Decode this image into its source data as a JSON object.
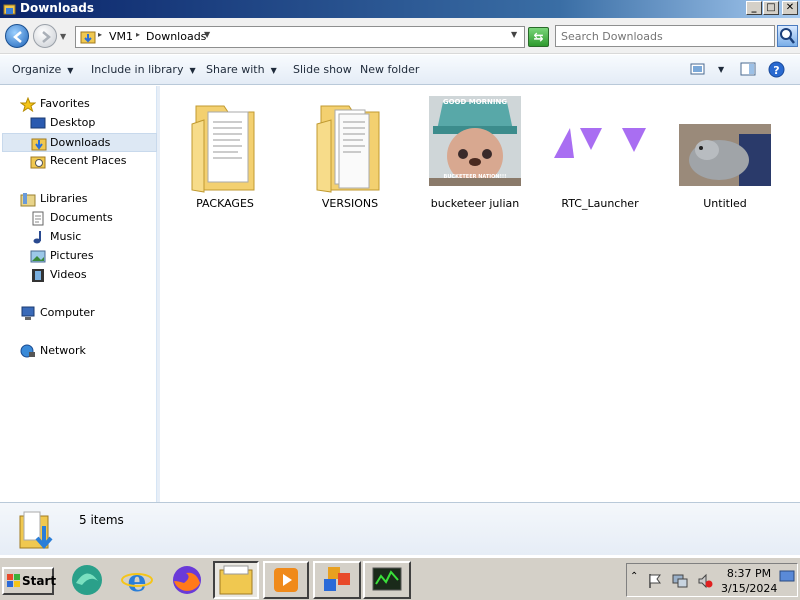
{
  "window": {
    "title": "Downloads"
  },
  "address": {
    "crumbs": [
      "VM1",
      "Downloads"
    ]
  },
  "search": {
    "placeholder": "Search Downloads"
  },
  "commands": {
    "organize": "Organize",
    "include": "Include in library",
    "share": "Share with",
    "slideshow": "Slide show",
    "newfolder": "New folder"
  },
  "nav": {
    "favorites": "Favorites",
    "desktop": "Desktop",
    "downloads": "Downloads",
    "recent": "Recent Places",
    "libraries": "Libraries",
    "documents": "Documents",
    "music": "Music",
    "pictures": "Pictures",
    "videos": "Videos",
    "computer": "Computer",
    "network": "Network"
  },
  "files": [
    {
      "name": "PACKAGES",
      "icon": "folder-documents-icon"
    },
    {
      "name": "VERSIONS",
      "icon": "folder-documents-icon"
    },
    {
      "name": "bucketeer julian",
      "icon": "image-thumbnail",
      "caption_top": "GOOD MORNING",
      "caption_bottom": "BUCKETEER NATION!!!"
    },
    {
      "name": "RTC_Launcher",
      "icon": "purple-triangles-icon"
    },
    {
      "name": "Untitled",
      "icon": "image-thumbnail"
    }
  ],
  "details": {
    "count": "5 items"
  },
  "taskbar": {
    "start": "Start",
    "time": "8:37 PM",
    "date": "3/15/2024"
  },
  "colors": {
    "accent": "#0a246a",
    "selection": "#dde8f4",
    "purple": "#a96ef2"
  }
}
